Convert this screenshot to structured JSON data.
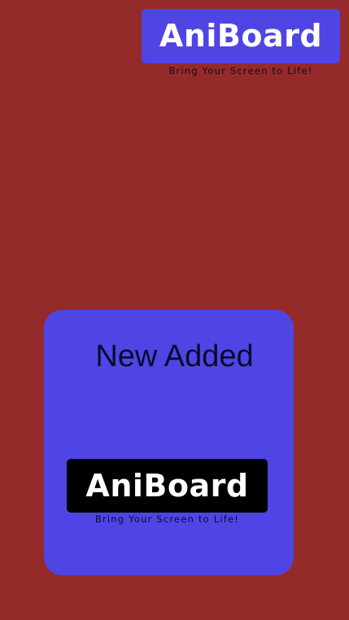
{
  "header": {
    "logo_text": "AniBoard",
    "tagline": "Bring Your Screen to Life!"
  },
  "card": {
    "title": "New Added",
    "logo_text": "AniBoard",
    "tagline": "Bring Your Screen to Life!"
  },
  "colors": {
    "background": "#952a2a",
    "accent": "#4f45e4",
    "logo_dark": "#000000",
    "text_light": "#ffffff"
  }
}
